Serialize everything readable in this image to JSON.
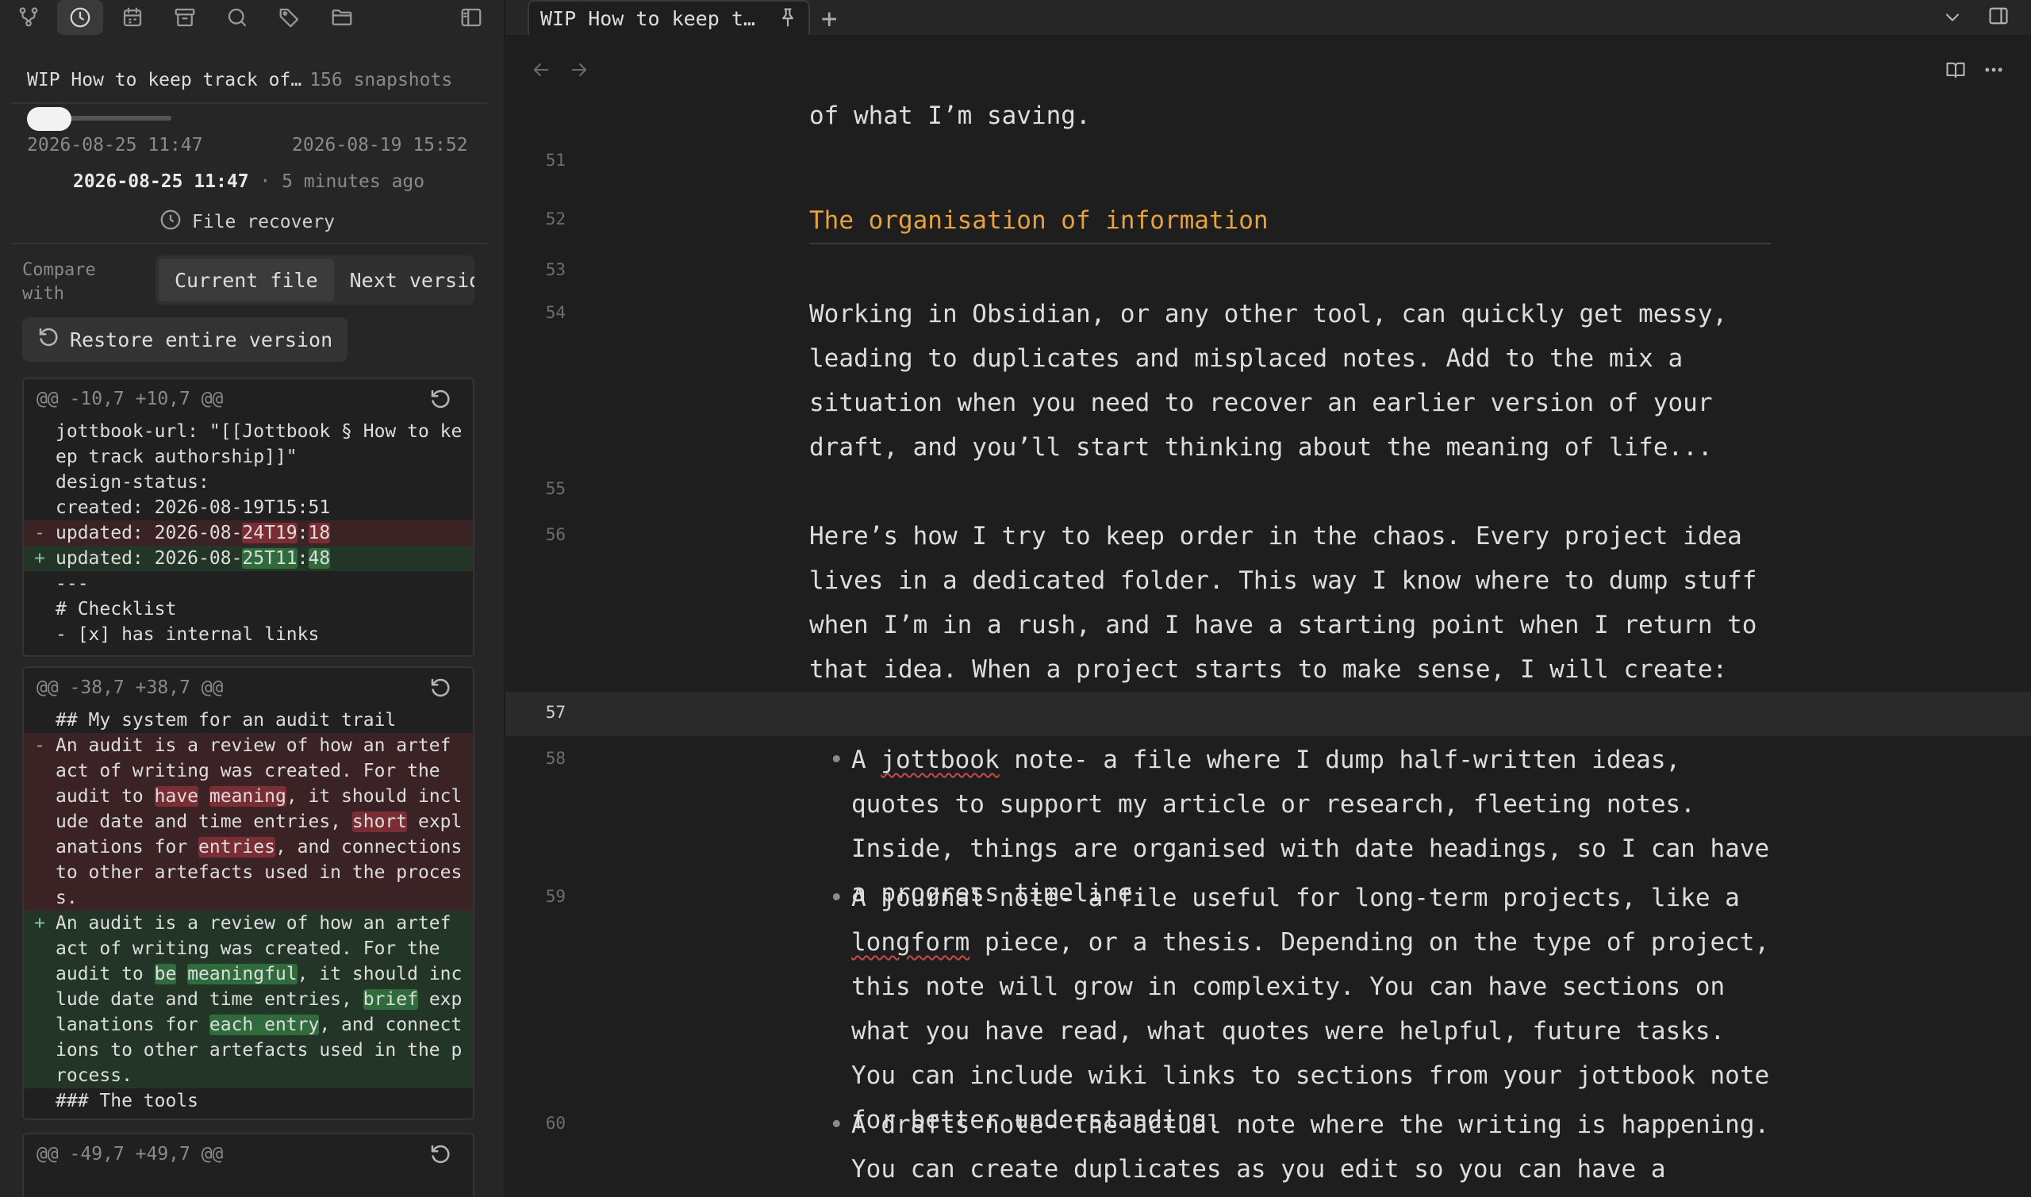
{
  "sidebar": {
    "file_name": "WIP How to keep track of…",
    "snapshot_count": "156 snapshots",
    "range_start": "2026-08-25 11:47",
    "range_end": "2026-08-19 15:52",
    "selected_date": "2026-08-25 11:47",
    "selected_sep": " · ",
    "selected_relative": "5 minutes ago",
    "recovery_label": "File recovery",
    "compare_label": "Compare with",
    "compare_current": "Current file",
    "compare_next": "Next version",
    "restore_label": "Restore entire version",
    "hunks": [
      {
        "header": "@@ -10,7 +10,7 @@",
        "lines": [
          {
            "t": "ctx",
            "m": " ",
            "s": "jottbook-url: \"[[Jottbook § How to ke"
          },
          {
            "t": "ctx",
            "m": " ",
            "s": "ep track authorship]]\""
          },
          {
            "t": "ctx",
            "m": " ",
            "s": "design-status:"
          },
          {
            "t": "ctx",
            "m": " ",
            "s": "created: 2026-08-19T15:51"
          },
          {
            "t": "del",
            "m": "-",
            "s": "updated: 2026-08-",
            "h": "24T19",
            "s2": ":",
            "h2": "18"
          },
          {
            "t": "add",
            "m": "+",
            "s": "updated: 2026-08-",
            "h": "25T11",
            "s2": ":",
            "h2": "48"
          },
          {
            "t": "ctx",
            "m": " ",
            "s": "---"
          },
          {
            "t": "ctx",
            "m": " ",
            "s": "# Checklist"
          },
          {
            "t": "ctx",
            "m": " ",
            "s": "- [x] has internal links"
          }
        ]
      },
      {
        "header": "@@ -38,7 +38,7 @@",
        "lines": [
          {
            "t": "ctx",
            "m": " ",
            "s": "## My system for an audit trail"
          },
          {
            "t": "del",
            "m": "-",
            "s": "An audit is a review of how an artef"
          },
          {
            "t": "del",
            "m": " ",
            "s": "act of writing was created. For the"
          },
          {
            "t": "del",
            "m": " ",
            "s": "audit to ",
            "h": "have",
            "s2": " ",
            "h2": "meaning",
            "s3": ", it should incl"
          },
          {
            "t": "del",
            "m": " ",
            "s": "ude date and time entries, ",
            "h": "short",
            "s2": " expl"
          },
          {
            "t": "del",
            "m": " ",
            "s": "anations for ",
            "h": "entries",
            "s2": ", and connections"
          },
          {
            "t": "del",
            "m": " ",
            "s": "to other artefacts used in the proces"
          },
          {
            "t": "del",
            "m": " ",
            "s": "s."
          },
          {
            "t": "add",
            "m": "+",
            "s": "An audit is a review of how an artef"
          },
          {
            "t": "add",
            "m": " ",
            "s": "act of writing was created. For the"
          },
          {
            "t": "add",
            "m": " ",
            "s": "audit to ",
            "h": "be",
            "s2": " ",
            "h2": "meaningful",
            "s3": ", it should inc"
          },
          {
            "t": "add",
            "m": " ",
            "s": "lude date and time entries, ",
            "h": "brief",
            "s2": " exp"
          },
          {
            "t": "add",
            "m": " ",
            "s": "lanations for ",
            "h": "each entry",
            "s2": ", and connect"
          },
          {
            "t": "add",
            "m": " ",
            "s": "ions to other artefacts used in the p"
          },
          {
            "t": "add",
            "m": " ",
            "s": "rocess."
          },
          {
            "t": "ctx",
            "m": " ",
            "s": "### The tools"
          }
        ]
      },
      {
        "header": "@@ -49,7 +49,7 @@",
        "lines": []
      }
    ]
  },
  "tab": {
    "title": "WIP How to keep t…",
    "new_tab": "+"
  },
  "editor": {
    "line_top_text": "of what I’m saving.",
    "lines": {
      "l51": "51",
      "l52": "52",
      "l53": "53",
      "l54": "54",
      "l55": "55",
      "l56": "56",
      "l57": "57",
      "l58": "58",
      "l59": "59",
      "l60": "60"
    },
    "heading": "The organisation of information",
    "p54": "Working in Obsidian, or any other tool, can quickly get messy, leading to duplicates and misplaced notes. Add to the mix a situation when you need to recover an earlier version of your draft, and you’ll start thinking about the meaning of life...",
    "p56": "Here’s how I try to keep order in the chaos. Every project idea lives in a dedicated folder. This way I know where to dump stuff when I’m in a rush, and I have a starting point when I return to that idea. When a project starts to make sense, I will create:",
    "li58_a": "A ",
    "li58_link": "jottbook",
    "li58_b": " note- a file where I dump half-written ideas, quotes to support my article or research, fleeting notes. Inside, things are organised with date headings, so I can have a progress timeline.",
    "li59_a": "A journal note- a file useful for long-term projects, like a ",
    "li59_link": "longform",
    "li59_b": " piece, or a thesis. Depending on the type of project, this note will grow in complexity. You can have sections on what you have read, what quotes were helpful, future tasks. You can include wiki links to sections from your jottbook note for better understanding.",
    "li60": "A drafts note- the actual note where the writing is happening. You can create duplicates as you edit so you can have a cleaner history of the",
    "bullet": "•"
  }
}
